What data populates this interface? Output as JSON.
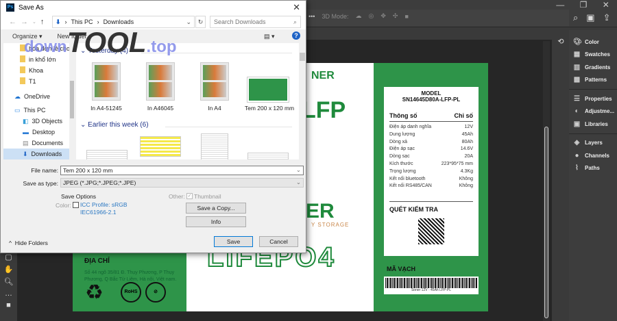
{
  "photoshop": {
    "options_bar": {
      "mode_label": "3D Mode:",
      "more": "•••"
    },
    "window_controls": [
      "—",
      "❐",
      "✕"
    ],
    "panels": [
      {
        "label": "Color",
        "icon": "palette-icon"
      },
      {
        "label": "Swatches",
        "icon": "swatches-icon"
      },
      {
        "label": "Gradients",
        "icon": "gradients-icon"
      },
      {
        "label": "Patterns",
        "icon": "patterns-icon"
      },
      {
        "label": "Properties",
        "icon": "sliders-icon"
      },
      {
        "label": "Adjustme...",
        "icon": "adjustments-icon"
      },
      {
        "label": "Libraries",
        "icon": "libraries-icon"
      },
      {
        "label": "Layers",
        "icon": "layers-icon"
      },
      {
        "label": "Channels",
        "icon": "channels-icon"
      },
      {
        "label": "Paths",
        "icon": "paths-icon"
      }
    ]
  },
  "artwork": {
    "brand_partial": "NER",
    "title_partial": "H LFP",
    "logo_partial": "ER",
    "storage_partial": "Y STORAGE",
    "lifepo4": "LIFEPO4",
    "address_heading": "ĐỊA CHỈ",
    "address": "Số 44 ngõ 35/81 Đ. Thụy Phương, P Thụy Phương, Q Bắc Từ Liêm, Hà nội, Việt nam.",
    "rohs": "RoHS",
    "spec": {
      "model_label": "MODEL",
      "model": "SN14645D80A-LFP-PL",
      "col_param": "Thông số",
      "col_value": "Chỉ số",
      "rows": [
        [
          "Điện áp danh nghĩa",
          "12V"
        ],
        [
          "Dung lượng",
          "45Ah"
        ],
        [
          "Dòng xả",
          "80Ah"
        ],
        [
          "Điện áp sạc",
          "14.6V"
        ],
        [
          "Dòng sạc",
          "20A"
        ],
        [
          "Kích thước",
          "223*95*75 mm"
        ],
        [
          "Trọng lượng",
          "4.3Kg"
        ],
        [
          "Kết nối bluetooth",
          "Không"
        ],
        [
          "Kết nối RS485/CAN",
          "Không"
        ]
      ],
      "scan_label": "QUÉT KIỂM TRA"
    },
    "barcode_label": "MÃ VẠCH",
    "barcode_text": "Soner 12V - 45Ah LFP-PL",
    "colors": {
      "green": "#2e9449",
      "dark_green": "#1f8a3c"
    }
  },
  "dialog": {
    "title": "Save As",
    "breadcrumb": [
      "This PC",
      "Downloads"
    ],
    "search_placeholder": "Search Downloads",
    "organize": "Organize ▾",
    "new_folder": "New folder",
    "nav_items": [
      {
        "label": "hóa đơn lẻ cho k",
        "type": "folder"
      },
      {
        "label": "in khổ lớn",
        "type": "folder"
      },
      {
        "label": "Khoa",
        "type": "folder"
      },
      {
        "label": "T1",
        "type": "folder"
      },
      {
        "label": "OneDrive",
        "type": "cloud"
      },
      {
        "label": "This PC",
        "type": "pc"
      },
      {
        "label": "3D Objects",
        "type": "3d"
      },
      {
        "label": "Desktop",
        "type": "desktop"
      },
      {
        "label": "Documents",
        "type": "documents"
      },
      {
        "label": "Downloads",
        "type": "downloads",
        "selected": true
      }
    ],
    "groups": [
      {
        "label": "Yesterday (4)",
        "files": [
          "In A4-51245",
          "In A46045",
          "In A4",
          "Tem 200 x 120 mm"
        ]
      },
      {
        "label": "Earlier this week (6)"
      }
    ],
    "file_name_label": "File name:",
    "file_name": "Tem 200 x 120 mm",
    "save_type_label": "Save as type:",
    "save_type": "JPEG (*.JPG;*.JPEG;*.JPE)",
    "save_options": "Save Options",
    "color_label": "Color:",
    "icc_profile": "ICC Profile:  sRGB",
    "icc_profile2": "IEC61966-2.1",
    "other_label": "Other:",
    "thumbnail": "Thumbnail",
    "save_copy": "Save a Copy...",
    "info": "Info",
    "save": "Save",
    "cancel": "Cancel",
    "hide_folders": "Hide Folders"
  },
  "watermark": {
    "part1": "down",
    "part2": "TOOL",
    ".top": ".top"
  }
}
